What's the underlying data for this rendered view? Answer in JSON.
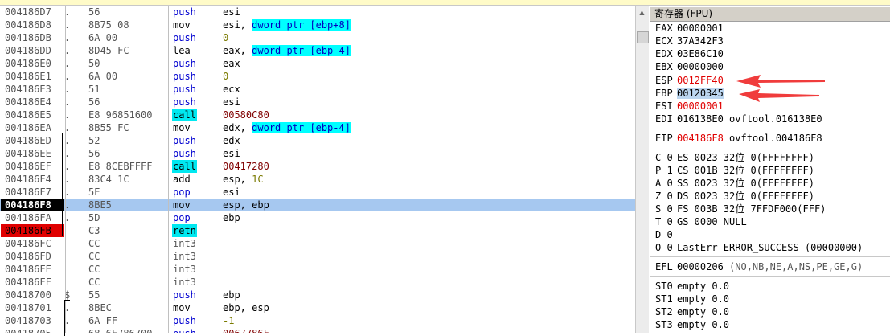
{
  "disasm": {
    "rows": [
      {
        "addr": "004186D7",
        "mark": ".",
        "hex": "56",
        "mnemonic": "push",
        "operand": "esi"
      },
      {
        "addr": "004186D8",
        "mark": ".",
        "hex": "8B75 08",
        "mnemonic": "mov",
        "operand": "esi,",
        "mem": "dword ptr [ebp+8]"
      },
      {
        "addr": "004186DB",
        "mark": ".",
        "hex": "6A 00",
        "mnemonic": "push",
        "num": "0"
      },
      {
        "addr": "004186DD",
        "mark": ".",
        "hex": "8D45 FC",
        "mnemonic": "lea",
        "operand": "eax,",
        "mem": "dword ptr [ebp-4]"
      },
      {
        "addr": "004186E0",
        "mark": ".",
        "hex": "50",
        "mnemonic": "push",
        "operand": "eax"
      },
      {
        "addr": "004186E1",
        "mark": ".",
        "hex": "6A 00",
        "mnemonic": "push",
        "num": "0"
      },
      {
        "addr": "004186E3",
        "mark": ".",
        "hex": "51",
        "mnemonic": "push",
        "operand": "ecx"
      },
      {
        "addr": "004186E4",
        "mark": ".",
        "hex": "56",
        "mnemonic": "push",
        "operand": "esi"
      },
      {
        "addr": "004186E5",
        "mark": ".",
        "hex": "E8 96851600",
        "mnemonic": "call",
        "addrop": "00580C80"
      },
      {
        "addr": "004186EA",
        "mark": ".",
        "hex": "8B55 FC",
        "mnemonic": "mov",
        "operand": "edx,",
        "mem": "dword ptr [ebp-4]"
      },
      {
        "addr": "004186ED",
        "mark": ".",
        "hex": "52",
        "mnemonic": "push",
        "operand": "edx"
      },
      {
        "addr": "004186EE",
        "mark": ".",
        "hex": "56",
        "mnemonic": "push",
        "operand": "esi"
      },
      {
        "addr": "004186EF",
        "mark": ".",
        "hex": "E8 8CEBFFFF",
        "mnemonic": "call",
        "addrop": "00417280"
      },
      {
        "addr": "004186F4",
        "mark": ".",
        "hex": "83C4 1C",
        "mnemonic": "add",
        "operand": "esp,",
        "num": "1C"
      },
      {
        "addr": "004186F7",
        "mark": ".",
        "hex": "5E",
        "mnemonic": "pop",
        "operand": "esi"
      },
      {
        "addr": "004186F8",
        "mark": ".",
        "hex": "8BE5",
        "mnemonic": "mov",
        "operand": "esp, ebp",
        "selected": true,
        "addrstyle": "black"
      },
      {
        "addr": "004186FA",
        "mark": ".",
        "hex": "5D",
        "mnemonic": "pop",
        "operand": "ebp"
      },
      {
        "addr": "004186FB",
        "mark": "",
        "hex": "C3",
        "mnemonic": "retn",
        "addrstyle": "red"
      },
      {
        "addr": "004186FC",
        "mark": "",
        "hex": "CC",
        "mnemonic": "int3"
      },
      {
        "addr": "004186FD",
        "mark": "",
        "hex": "CC",
        "mnemonic": "int3"
      },
      {
        "addr": "004186FE",
        "mark": "",
        "hex": "CC",
        "mnemonic": "int3"
      },
      {
        "addr": "004186FF",
        "mark": "",
        "hex": "CC",
        "mnemonic": "int3"
      },
      {
        "addr": "00418700",
        "mark": "$",
        "hex": "55",
        "mnemonic": "push",
        "operand": "ebp"
      },
      {
        "addr": "00418701",
        "mark": ".",
        "hex": "8BEC",
        "mnemonic": "mov",
        "operand": "ebp, esp"
      },
      {
        "addr": "00418703",
        "mark": ".",
        "hex": "6A FF",
        "mnemonic": "push",
        "num": "-1"
      },
      {
        "addr": "00418705",
        "mark": ".",
        "hex": "68 6F786700",
        "mnemonic": "push",
        "addrop": "0067786F"
      }
    ]
  },
  "scrollbar": {
    "up_arrow": "▲"
  },
  "registers": {
    "title": "寄存器 (FPU)",
    "eax": {
      "name": "EAX",
      "value": "00000001"
    },
    "ecx": {
      "name": "ECX",
      "value": "37A342F3"
    },
    "edx": {
      "name": "EDX",
      "value": "03E86C10"
    },
    "ebx": {
      "name": "EBX",
      "value": "00000000"
    },
    "esp": {
      "name": "ESP",
      "value": "0012FF40"
    },
    "ebp": {
      "name": "EBP",
      "value": "00120345"
    },
    "esi": {
      "name": "ESI",
      "value": "00000001"
    },
    "edi": {
      "name": "EDI",
      "value": "016138E0",
      "comment": "ovftool.016138E0"
    },
    "eip": {
      "name": "EIP",
      "value": "004186F8",
      "comment": "ovftool.004186F8"
    },
    "flags": [
      {
        "f": "C 0",
        "seg": "ES 0023 32位 0(FFFFFFFF)"
      },
      {
        "f": "P 1",
        "seg": "CS 001B 32位 0(FFFFFFFF)"
      },
      {
        "f": "A 0",
        "seg": "SS 0023 32位 0(FFFFFFFF)"
      },
      {
        "f": "Z 0",
        "seg": "DS 0023 32位 0(FFFFFFFF)"
      },
      {
        "f": "S 0",
        "seg": "FS 003B 32位 7FFDF000(FFF)"
      },
      {
        "f": "T 0",
        "seg": "GS 0000 NULL"
      },
      {
        "f": "D 0",
        "seg": ""
      },
      {
        "f": "O 0",
        "seg": "LastErr ERROR_SUCCESS (00000000)"
      }
    ],
    "efl": {
      "name": "EFL",
      "value": "00000206",
      "desc": "(NO,NB,NE,A,NS,PE,GE,G)"
    },
    "st": [
      {
        "name": "ST0",
        "value": "empty 0.0"
      },
      {
        "name": "ST1",
        "value": "empty 0.0"
      },
      {
        "name": "ST2",
        "value": "empty 0.0"
      },
      {
        "name": "ST3",
        "value": "empty 0.0"
      }
    ]
  },
  "colors": {
    "annotation_arrow": "#f03c3c",
    "selected_row": "#a6c8f0",
    "call_highlight": "#00e8f0",
    "register_changed": "#e00000"
  }
}
